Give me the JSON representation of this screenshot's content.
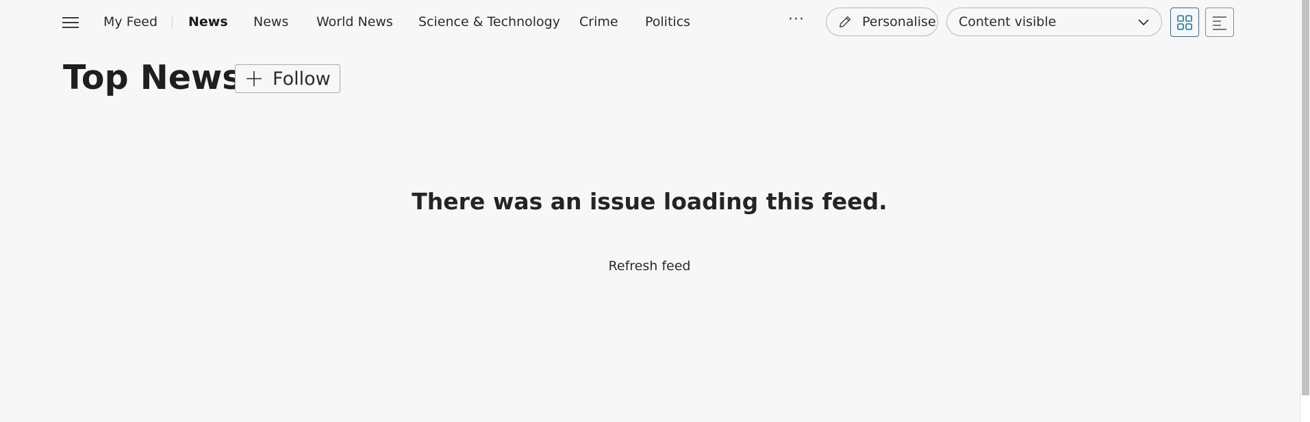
{
  "nav": {
    "menu_icon": "hamburger-menu-icon",
    "items": [
      {
        "label": "My Feed"
      },
      {
        "label": "News",
        "active": true
      },
      {
        "label": "News"
      },
      {
        "label": "World News"
      },
      {
        "label": "Science & Technology"
      },
      {
        "label": "Crime"
      },
      {
        "label": "Politics"
      }
    ],
    "more_label": "···"
  },
  "toolbar": {
    "personalise_label": "Personalise",
    "personalise_icon": "pencil-icon",
    "content_select_value": "Content visible",
    "content_select_icon": "chevron-down-icon",
    "grid_view_icon": "grid-view-icon",
    "list_view_icon": "list-view-icon",
    "accent_color": "#1a6fb5"
  },
  "header": {
    "title": "Top News",
    "follow_label": "Follow",
    "follow_icon": "plus-icon"
  },
  "feed": {
    "error_message": "There was an issue loading this feed.",
    "refresh_label": "Refresh feed"
  }
}
